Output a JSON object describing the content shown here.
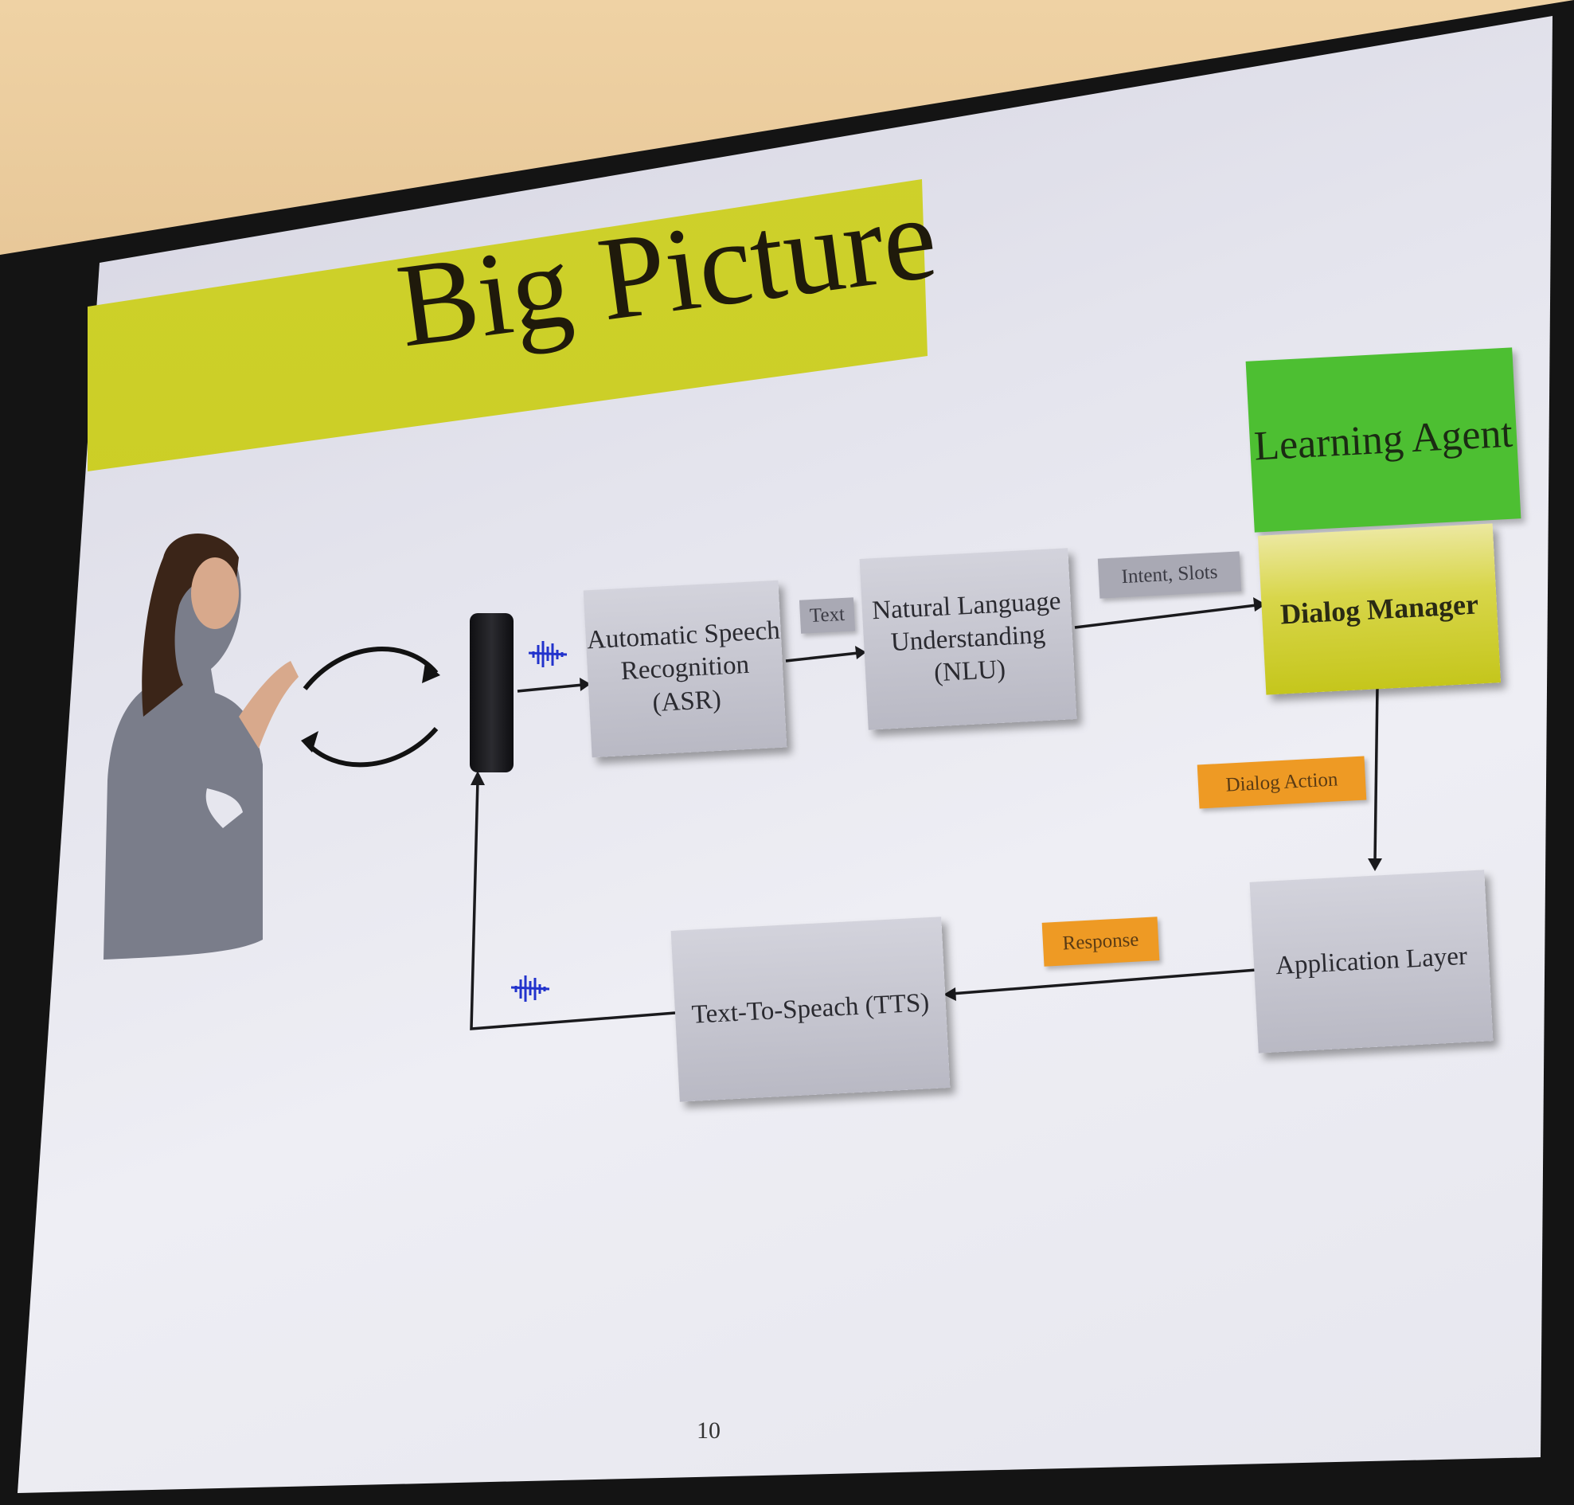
{
  "slide": {
    "title": "Big Picture",
    "page_number": "10"
  },
  "diagram": {
    "nodes": {
      "asr": "Automatic Speech Recognition (ASR)",
      "nlu": "Natural Language Understanding (NLU)",
      "learning_agent": "Learning Agent",
      "dialog_manager": "Dialog Manager",
      "application_layer": "Application Layer",
      "tts": "Text-To-Speach (TTS)"
    },
    "edge_labels": {
      "text": "Text",
      "intent_slots": "Intent, Slots",
      "dialog_action": "Dialog Action",
      "response": "Response"
    }
  },
  "colors": {
    "title_band": "#cdd024",
    "learning_agent": "#4dbf32",
    "dialog_manager": "#d3d33a",
    "orange_tag": "#ee9a24",
    "gray_tag": "#a9a9b4"
  }
}
